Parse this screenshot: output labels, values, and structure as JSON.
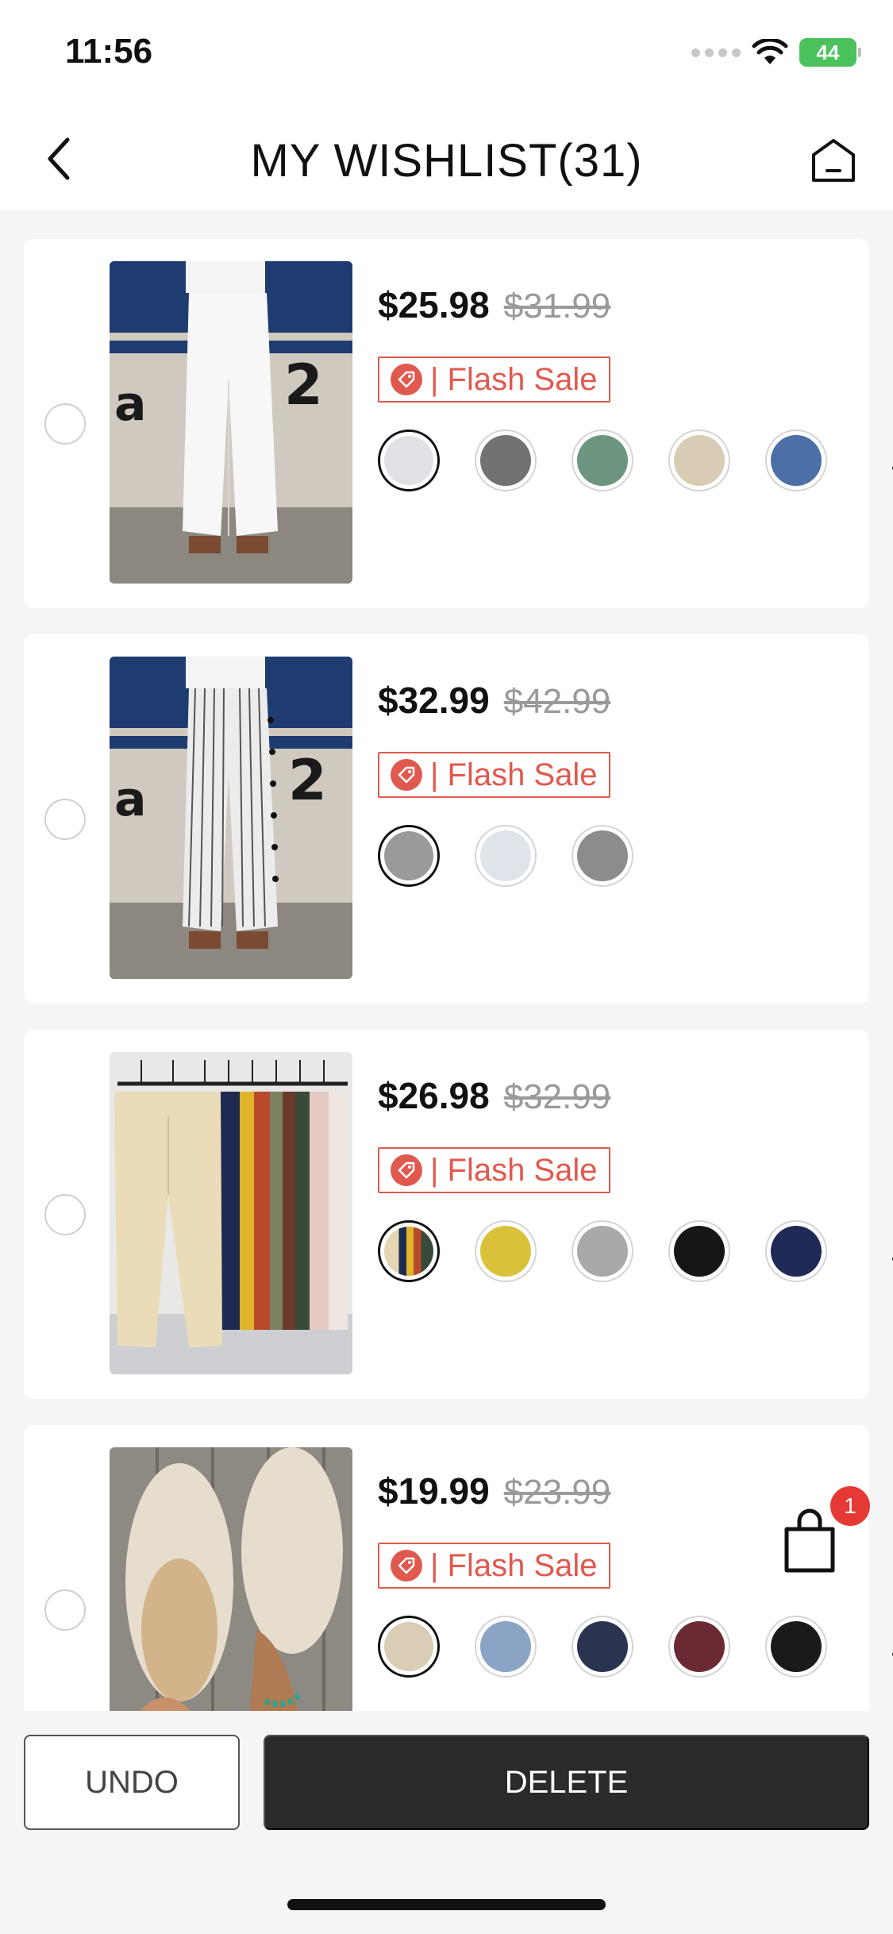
{
  "status_bar": {
    "time": "11:56",
    "battery": "44"
  },
  "header": {
    "title": "MY WISHLIST(31)"
  },
  "items": [
    {
      "price_now": "$25.98",
      "price_old": "$31.99",
      "badge": "| Flash Sale",
      "swatches": [
        "#dfe1e4",
        "#707274",
        "#6e9580",
        "#d8cdb4",
        "#4c6fa8"
      ],
      "has_more": true
    },
    {
      "price_now": "$32.99",
      "price_old": "$42.99",
      "badge": "| Flash Sale",
      "swatches": [
        "#9a9a9a",
        "#dfe4ea",
        "#8c8c8c"
      ],
      "has_more": false
    },
    {
      "price_now": "$26.98",
      "price_old": "$32.99",
      "badge": "| Flash Sale",
      "swatches": [
        "#e4d6b3",
        "#d9c23a",
        "#a9a9a9",
        "#161616",
        "#1f2a56"
      ],
      "has_more": true
    },
    {
      "price_now": "$19.99",
      "price_old": "$23.99",
      "badge": "| Flash Sale",
      "swatches": [
        "#d9cdb5",
        "#8ba3c4",
        "#2a3350",
        "#6b2a33",
        "#1a1a1a"
      ],
      "has_more": true
    }
  ],
  "cart": {
    "count": "1"
  },
  "actions": {
    "undo": "UNDO",
    "delete": "DELETE"
  },
  "more_label": "···",
  "colors": {
    "accent": "#e0594f",
    "badge_red": "#e53935",
    "primary_button": "#2a2a2a"
  }
}
